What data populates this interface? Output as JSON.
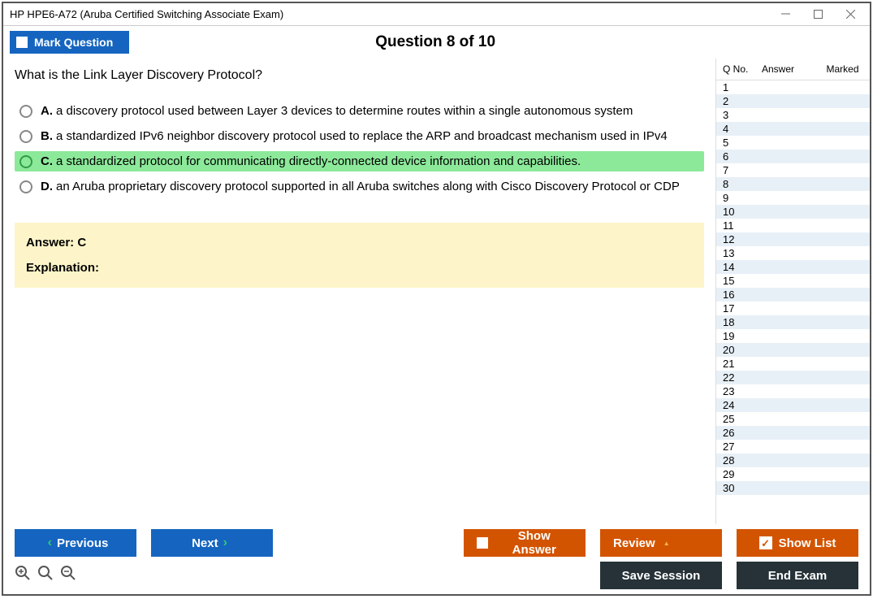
{
  "window": {
    "title": "HP HPE6-A72 (Aruba Certified Switching Associate Exam)"
  },
  "header": {
    "mark_label": "Mark Question",
    "question_counter": "Question 8 of 10"
  },
  "question": {
    "text": "What is the Link Layer Discovery Protocol?",
    "options": [
      {
        "letter": "A.",
        "text": "a discovery protocol used between Layer 3 devices to determine routes within a single autonomous system"
      },
      {
        "letter": "B.",
        "text": "a standardized IPv6 neighbor discovery protocol used to replace the ARP and broadcast mechanism used in IPv4"
      },
      {
        "letter": "C.",
        "text": "a standardized protocol for communicating directly-connected device information and capabilities."
      },
      {
        "letter": "D.",
        "text": "an Aruba proprietary discovery protocol supported in all Aruba switches along with Cisco Discovery Protocol or CDP"
      }
    ],
    "correct_index": 2
  },
  "answer_box": {
    "answer": "Answer: C",
    "explanation_label": "Explanation:"
  },
  "sidebar": {
    "columns": {
      "qno": "Q No.",
      "answer": "Answer",
      "marked": "Marked"
    },
    "rows": [
      1,
      2,
      3,
      4,
      5,
      6,
      7,
      8,
      9,
      10,
      11,
      12,
      13,
      14,
      15,
      16,
      17,
      18,
      19,
      20,
      21,
      22,
      23,
      24,
      25,
      26,
      27,
      28,
      29,
      30
    ]
  },
  "footer": {
    "previous": "Previous",
    "next": "Next",
    "show_answer": "Show Answer",
    "review": "Review",
    "show_list": "Show List",
    "save_session": "Save Session",
    "end_exam": "End Exam"
  }
}
